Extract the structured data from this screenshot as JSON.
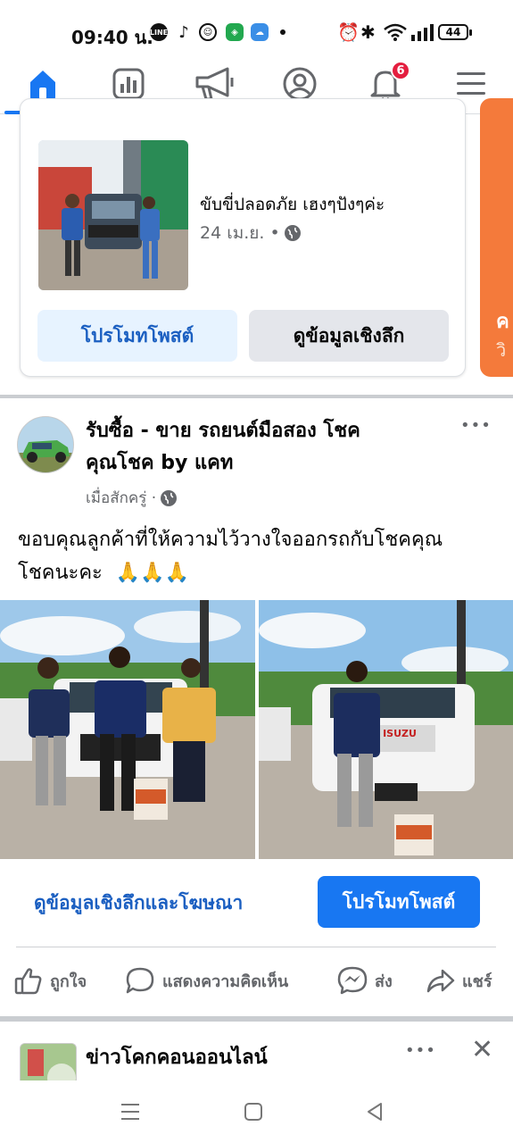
{
  "status_bar": {
    "time": "09:40 น.",
    "battery": "44",
    "app_icons": [
      "line-icon",
      "tiktok-icon",
      "app-icon",
      "shield-app-icon",
      "weather-icon"
    ],
    "right_icons": [
      "alarm-icon",
      "bluetooth-icon",
      "wifi-icon",
      "signal-icon",
      "battery-icon"
    ]
  },
  "nav": {
    "items": [
      "home-icon",
      "insights-icon",
      "megaphone-icon",
      "profile-icon",
      "notifications-icon",
      "menu-icon"
    ],
    "notification_count": "6",
    "accent": "#1877f2"
  },
  "boost_card": {
    "caption": "ขับขี่ปลอดภัย เฮงๆปังๆค่ะ",
    "date": "24 เม.ย. •",
    "promote_label": "โปรโมทโพสต์",
    "insights_label": "ดูข้อมูลเชิงลึก",
    "side_card_letter": "ค",
    "side_card_sub": "วิ"
  },
  "post": {
    "page_name_line1": "รับซื้อ - ขาย รถยนต์มือสอง โชค",
    "page_name_line2": "คุณโชค by แคท",
    "time": "เมื่อสักครู่ ·",
    "text_line1": "ขอบคุณลูกค้าที่ให้ความไว้วางใจออกรถกับโชคคุณ",
    "text_line2": "โชคนะคะ",
    "emoji": "🙏🙏🙏",
    "more": "•••",
    "insights_ads_label": "ดูข้อมูลเชิงลึกและโฆษณา",
    "promote_label": "โปรโมทโพสต์",
    "actions": {
      "like": "ถูกใจ",
      "comment": "แสดงความคิดเห็น",
      "send": "ส่ง",
      "share": "แชร์"
    },
    "photo_left_brand": "",
    "photo_right_brand": "ISUZU"
  },
  "next_post": {
    "title": "ข่าวโคกคอนออนไลน์",
    "more": "•••",
    "close": "✕"
  }
}
